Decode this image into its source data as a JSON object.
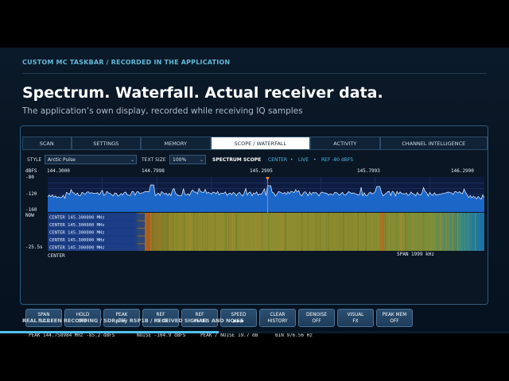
{
  "slide": {
    "kicker": "CUSTOM MC TASKBAR / RECORDED IN THE APPLICATION",
    "headline": "Spectrum. Waterfall. Actual receiver data.",
    "subline": "The application’s own display, recorded while receiving IQ samples",
    "footer": "REAL SCREEN RECORDING / SDRplay RSP1B / RECEIVED SIGNALS AND NOISE",
    "progress_fraction": 0.43
  },
  "tabs": [
    {
      "label": "SCAN",
      "active": false
    },
    {
      "label": "SETTINGS",
      "active": false
    },
    {
      "label": "MEMORY",
      "active": false
    },
    {
      "label": "SCOPE / WATERFALL",
      "active": true
    },
    {
      "label": "ACTIVITY",
      "active": false
    },
    {
      "label": "CHANNEL INTELLIGENCE",
      "active": false
    }
  ],
  "toolbar": {
    "style_label": "STYLE",
    "style_value": "Arctic Pulse",
    "text_size_label": "TEXT SIZE",
    "text_size_value": "100%",
    "scope_title": "SPECTRUM SCOPE",
    "center_label": "CENTER",
    "dot": "•",
    "live_label": "LIVE",
    "ref_label": "REF -80 dBFS"
  },
  "scope": {
    "unit_label": "dBFS",
    "freq_ticks": [
      "144.3000",
      "144.7998",
      "145.2995",
      "145.7993",
      "146.2990"
    ],
    "db_ticks": [
      "-80",
      "-120",
      "-160"
    ],
    "time_now": "NOW",
    "time_past": "-25.5s",
    "center_caption": "CENTER",
    "span_caption": "SPAN 1999 kHz",
    "history_label": "CENTER 145.300000 MHz",
    "history_rows": 5,
    "colors": {
      "spectrum_fill": "#1c66c8",
      "spectrum_line": "#e8f6ff",
      "marker": "#ff8a1e",
      "grid": "#2a3f66"
    }
  },
  "controls": [
    {
      "line1": "SPAN",
      "line2": "FULL"
    },
    {
      "line1": "HOLD",
      "line2": "OFF"
    },
    {
      "line1": "PEAK",
      "line2": "OFF"
    },
    {
      "line1": "REF",
      "line2": "−5 dB"
    },
    {
      "line1": "REF",
      "line2": "+5 dB"
    },
    {
      "line1": "SPEED",
      "line2": "▶▶▶"
    },
    {
      "line1": "CLEAR",
      "line2": "HISTORY"
    },
    {
      "line1": "DENOISE",
      "line2": "OFF"
    },
    {
      "line1": "VISUAL",
      "line2": "FX"
    },
    {
      "line1": "PEAK MEM",
      "line2": "OFF"
    }
  ],
  "status": {
    "peak": "PEAK 144.758984 MHz  -85.2 dBFS",
    "noise": "NOISE -104.9 dBFS",
    "ratio": "PEAK / NOISE 19.7 dB",
    "bin": "BIN 976.56 Hz"
  }
}
